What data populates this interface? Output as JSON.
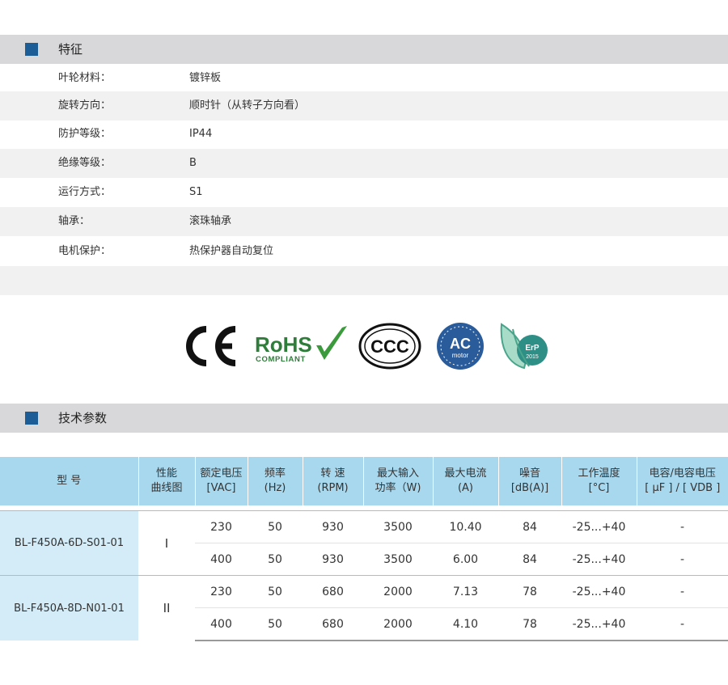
{
  "features": {
    "title": "特征",
    "rows": [
      {
        "label": "叶轮材料：",
        "value": "镀锌板"
      },
      {
        "label": "旋转方向：",
        "value": "顺时针（从转子方向看）"
      },
      {
        "label": "防护等级：",
        "value": "IP44"
      },
      {
        "label": "绝缘等级：",
        "value": "B"
      },
      {
        "label": "运行方式：",
        "value": "S1"
      },
      {
        "label": "轴承：",
        "value": "滚珠轴承"
      },
      {
        "label": "电机保护：",
        "value": "热保护器自动复位"
      }
    ]
  },
  "certifications": {
    "ce": "CE",
    "rohs_main": "RoHS",
    "rohs_sub": "COMPLIANT",
    "ccc": "CCC",
    "ac_top": "AC",
    "ac_sub": "motor",
    "erp_top": "ErP",
    "erp_sub": "2015"
  },
  "specs": {
    "title": "技术参数",
    "headers": [
      [
        "型 号"
      ],
      [
        "性能",
        "曲线图"
      ],
      [
        "额定电压",
        "[VAC]"
      ],
      [
        "频率",
        "(Hz)"
      ],
      [
        "转 速",
        "(RPM)"
      ],
      [
        "最大输入",
        "功率（W)"
      ],
      [
        "最大电流",
        "(A)"
      ],
      [
        "噪音",
        "[dB(A)]"
      ],
      [
        "工作温度",
        "[°C]"
      ],
      [
        "电容/电容电压",
        "[ μF ] / [ VDB ]"
      ]
    ],
    "models": [
      {
        "name": "BL-F450A-6D-S01-01",
        "curve": "I",
        "rows": [
          {
            "voltage": "230",
            "freq": "50",
            "rpm": "930",
            "power": "3500",
            "current": "10.40",
            "noise": "84",
            "temp": "-25...+40",
            "cap": "-"
          },
          {
            "voltage": "400",
            "freq": "50",
            "rpm": "930",
            "power": "3500",
            "current": "6.00",
            "noise": "84",
            "temp": "-25...+40",
            "cap": "-"
          }
        ]
      },
      {
        "name": "BL-F450A-8D-N01-01",
        "curve": "II",
        "rows": [
          {
            "voltage": "230",
            "freq": "50",
            "rpm": "680",
            "power": "2000",
            "current": "7.13",
            "noise": "78",
            "temp": "-25...+40",
            "cap": "-"
          },
          {
            "voltage": "400",
            "freq": "50",
            "rpm": "680",
            "power": "2000",
            "current": "4.10",
            "noise": "78",
            "temp": "-25...+40",
            "cap": "-"
          }
        ]
      }
    ]
  },
  "colors": {
    "section_bar": "#d8d8da",
    "accent_square": "#1c5d97",
    "header_fill": "#a8d8ee",
    "model_fill": "#d3ecf8"
  }
}
